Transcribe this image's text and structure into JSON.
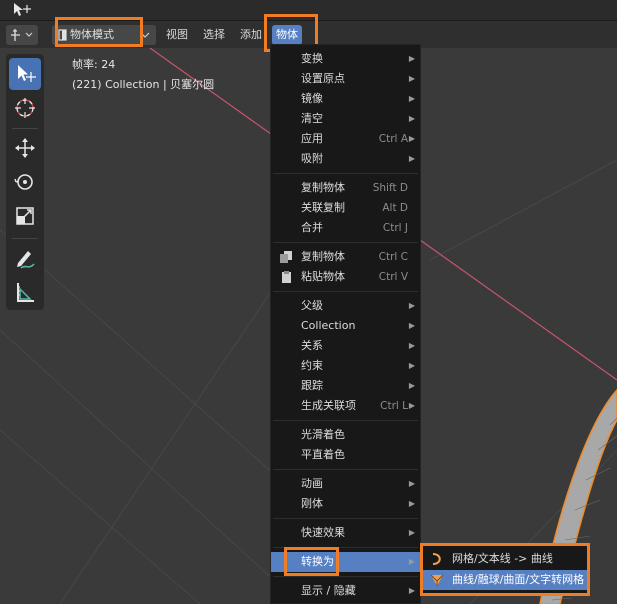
{
  "header": {
    "mode_label": "物体模式",
    "menus": [
      "视图",
      "选择",
      "添加",
      "物体"
    ]
  },
  "overlay": {
    "fps": "帧率: 24",
    "object_info": "(221) Collection | 贝塞尔圆"
  },
  "toolbar": {
    "tools": [
      "select-icon",
      "cursor-icon",
      "move-icon",
      "rotate-icon",
      "scale-icon",
      "annotate-icon",
      "measure-icon"
    ]
  },
  "object_menu": {
    "items": [
      {
        "label": "变换",
        "shortcut": "",
        "submenu": true
      },
      {
        "label": "设置原点",
        "shortcut": "",
        "submenu": true
      },
      {
        "label": "镜像",
        "shortcut": "",
        "submenu": true
      },
      {
        "label": "清空",
        "shortcut": "",
        "submenu": true
      },
      {
        "label": "应用",
        "shortcut": "Ctrl A",
        "submenu": true
      },
      {
        "label": "吸附",
        "shortcut": "",
        "submenu": true
      },
      {
        "label": "复制物体",
        "shortcut": "Shift D",
        "submenu": false
      },
      {
        "label": "关联复制",
        "shortcut": "Alt D",
        "submenu": false
      },
      {
        "label": "合并",
        "shortcut": "Ctrl J",
        "submenu": false
      },
      {
        "label": "复制物体",
        "shortcut": "Ctrl C",
        "submenu": false,
        "icon": "copy-icon"
      },
      {
        "label": "粘贴物体",
        "shortcut": "Ctrl V",
        "submenu": false,
        "icon": "paste-icon"
      },
      {
        "label": "父级",
        "shortcut": "",
        "submenu": true
      },
      {
        "label": "Collection",
        "shortcut": "",
        "submenu": true
      },
      {
        "label": "关系",
        "shortcut": "",
        "submenu": true
      },
      {
        "label": "约束",
        "shortcut": "",
        "submenu": true
      },
      {
        "label": "跟踪",
        "shortcut": "",
        "submenu": true
      },
      {
        "label": "生成关联项",
        "shortcut": "Ctrl L",
        "submenu": true
      },
      {
        "label": "光滑着色",
        "shortcut": "",
        "submenu": false
      },
      {
        "label": "平直着色",
        "shortcut": "",
        "submenu": false
      },
      {
        "label": "动画",
        "shortcut": "",
        "submenu": true
      },
      {
        "label": "刚体",
        "shortcut": "",
        "submenu": true
      },
      {
        "label": "快速效果",
        "shortcut": "",
        "submenu": true
      },
      {
        "label": "转换为",
        "shortcut": "",
        "submenu": true
      },
      {
        "label": "显示 / 隐藏",
        "shortcut": "",
        "submenu": true
      }
    ]
  },
  "convert_submenu": {
    "items": [
      {
        "label": "网格/文本线 -> 曲线",
        "icon": "curve-icon"
      },
      {
        "label": "曲线/融球/曲面/文字转网格",
        "icon": "mesh-icon"
      }
    ]
  },
  "colors": {
    "highlight_box": "#f07d23",
    "active_blue": "#5680c2",
    "menu_bg": "#181818"
  }
}
